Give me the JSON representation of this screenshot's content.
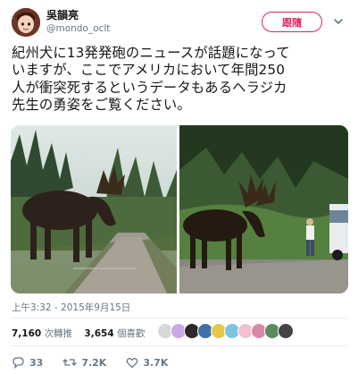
{
  "author": {
    "display_name": "吳韻亮",
    "handle": "@mondo_oclt"
  },
  "follow_button": {
    "label": "跟隨"
  },
  "tweet": {
    "lines": [
      "紀州犬に13発発砲のニュースが話題になって",
      "いますが、ここでアメリカにおいて年間250",
      "人が衝突死するというデータもあるヘラジカ",
      "先生の勇姿をご覧ください。"
    ],
    "timestamp": "上午3:32 - 2015年9月15日"
  },
  "stats": {
    "retweets_count": "7,160",
    "retweets_label": "次轉推",
    "likes_count": "3,654",
    "likes_label": "個喜歡"
  },
  "liker_avatar_colors": [
    "#d9d9d9",
    "#c9a7e8",
    "#2a2a2a",
    "#3f6fa8",
    "#e4c94a",
    "#7cc4e0",
    "#f2c1cf",
    "#d78aa6",
    "#5b8a5e",
    "#444444"
  ],
  "actions": {
    "reply_count": "33",
    "retweet_count": "7.2K",
    "like_count": "3.7K"
  },
  "colors": {
    "accent": "#e0245e",
    "secondary_text": "#657786"
  }
}
